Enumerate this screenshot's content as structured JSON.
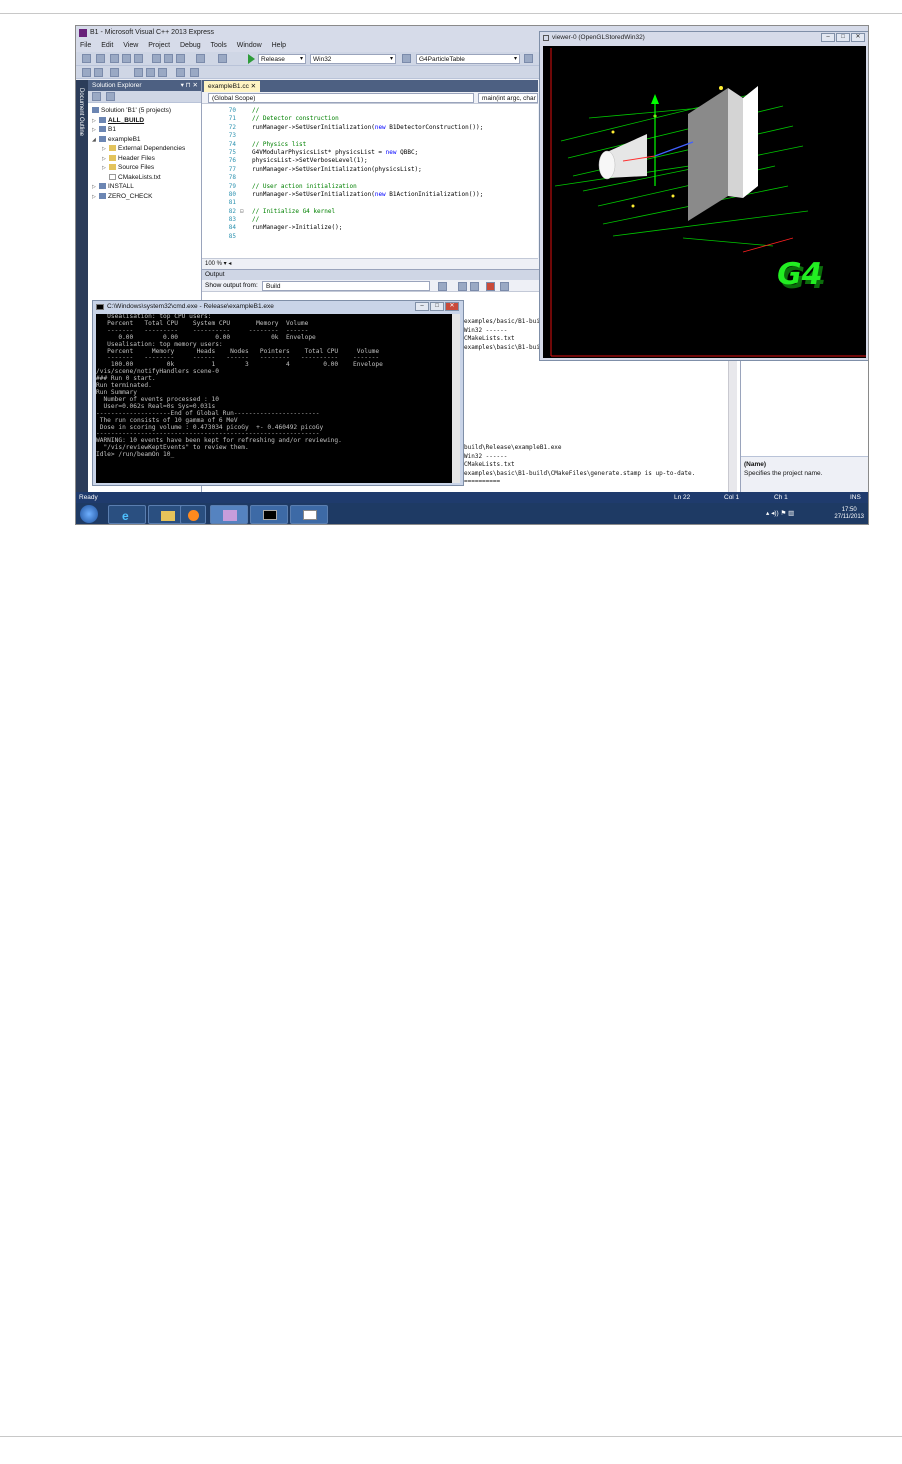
{
  "vs": {
    "title": "B1 - Microsoft Visual C++ 2013 Express",
    "menu": [
      "File",
      "Edit",
      "View",
      "Project",
      "Debug",
      "Tools",
      "Window",
      "Help"
    ],
    "config": "Release",
    "platform": "Win32",
    "target": "G4ParticleTable",
    "doc_outline": "Document Outline"
  },
  "solution_explorer": {
    "title": "Solution Explorer",
    "controls": "▾ ⊓ ✕",
    "items": [
      "Solution 'B1' (5 projects)",
      "ALL_BUILD",
      "B1",
      "exampleB1",
      "External Dependencies",
      "Header Files",
      "Source Files",
      "CMakeLists.txt",
      "INSTALL",
      "ZERO_CHECK"
    ]
  },
  "editor": {
    "tab": "exampleB1.cc",
    "scope": "(Global Scope)",
    "member": "main(int argc, char",
    "zoom": "100 %",
    "lines": [
      {
        "n": "70",
        "t": "//"
      },
      {
        "n": "71",
        "t": "// Detector construction"
      },
      {
        "n": "72",
        "t": "runManager->SetUserInitialization(new B1DetectorConstruction());"
      },
      {
        "n": "73",
        "t": ""
      },
      {
        "n": "74",
        "t": "// Physics list"
      },
      {
        "n": "75",
        "t": "G4VModularPhysicsList* physicsList = new QBBC;"
      },
      {
        "n": "76",
        "t": "physicsList->SetVerboseLevel(1);"
      },
      {
        "n": "77",
        "t": "runManager->SetUserInitialization(physicsList);"
      },
      {
        "n": "78",
        "t": ""
      },
      {
        "n": "79",
        "t": "// User action initialization"
      },
      {
        "n": "80",
        "t": "runManager->SetUserInitialization(new B1ActionInitialization());"
      },
      {
        "n": "81",
        "t": ""
      },
      {
        "n": "82",
        "t": "// Initialize G4 kernel"
      },
      {
        "n": "83",
        "t": "//"
      },
      {
        "n": "84",
        "t": "runManager->Initialize();"
      },
      {
        "n": "85",
        "t": ""
      }
    ]
  },
  "output": {
    "title": "Output",
    "show_from_label": "Show output from:",
    "show_from_value": "Build",
    "lines_top": [
      "examples/basic/B1-bui",
      "Win32 ------",
      "CMakeLists.txt",
      "examples\\basic\\B1-bui"
    ],
    "lines_bottom": [
      "build\\Release\\exampleB1.exe",
      "Win32 ------",
      "CMakeLists.txt",
      "examples\\basic\\B1-build\\CMakeFiles\\generate.stamp is up-to-date.",
      "",
      "=========="
    ]
  },
  "properties": {
    "desc_title": "(Name)",
    "desc_text": "Specifies the project name."
  },
  "viewer": {
    "title": "viewer-0 (OpenGLStoredWin32)",
    "logo": "G4"
  },
  "cmd": {
    "title": "C:\\Windows\\system32\\cmd.exe - Release\\exampleB1.exe",
    "lines": [
      "   Usealisation: top CPU users:",
      "   Percent   Total CPU    System CPU       Memory  Volume",
      "   -------   ---------    ----------     --------  ------",
      "      0.00        0.00          0.00           0k  Envelope",
      "",
      "   Usealisation: top memory users:",
      "   Percent     Memory      Heads    Nodes   Pointers    Total CPU     Volume",
      "   -------   --------     ------   ------   --------   ----------    -------",
      "",
      "    100.00         0k          1        3          4         0.00    Envelope",
      "/vis/scene/notifyHandlers scene-0",
      "### Run 0 start.",
      "Run terminated.",
      "Run Summary",
      "  Number of events processed : 10",
      "  User=0.062s Real=0s Sys=0.031s",
      "",
      "--------------------End of Global Run-----------------------",
      " The run consists of 10 gamma of 6 MeV",
      " Dose in scoring volume : 0.473034 picoGy  +- 0.460492 picoGy",
      "------------------------------------------------------------",
      "",
      "WARNING: 10 events have been kept for refreshing and/or reviewing.",
      "  \"/vis/reviewKeptEvents\" to review them.",
      "Idle> /run/beamOn 10_"
    ]
  },
  "status": {
    "ready": "Ready",
    "ln": "Ln 22",
    "col": "Col 1",
    "ch": "Ch 1",
    "ins": "INS"
  },
  "taskbar": {
    "time": "17:50",
    "date": "27/11/2013"
  }
}
